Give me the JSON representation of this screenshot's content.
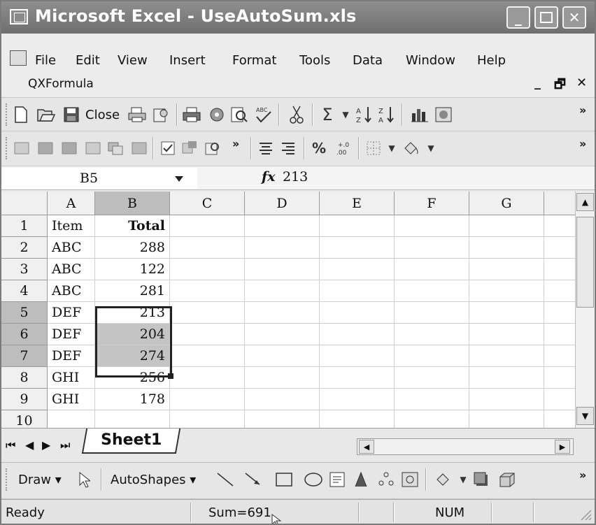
{
  "window": {
    "title": "Microsoft Excel - UseAutoSum.xls",
    "controls": {
      "minimize": "_",
      "maximize": "□",
      "close": "✕"
    }
  },
  "menu": {
    "items": [
      "File",
      "Edit",
      "View",
      "Insert",
      "Format",
      "Tools",
      "Data",
      "Window",
      "Help"
    ],
    "extra": "QXFormula",
    "mdi_controls": {
      "minimize": "_",
      "restore": "🗗",
      "close": "✕"
    }
  },
  "standard_toolbar": {
    "close_label": "Close",
    "overflow": "»"
  },
  "formatting_toolbar": {
    "overflow": "»"
  },
  "formula_bar": {
    "name_box": "B5",
    "fx": "fx",
    "value": "213"
  },
  "grid": {
    "columns": [
      "A",
      "B",
      "C",
      "D",
      "E",
      "F",
      "G"
    ],
    "rows": [
      {
        "num": "1",
        "a": "Item",
        "b": "Total"
      },
      {
        "num": "2",
        "a": "ABC",
        "b": "288"
      },
      {
        "num": "3",
        "a": "ABC",
        "b": "122"
      },
      {
        "num": "4",
        "a": "ABC",
        "b": "281"
      },
      {
        "num": "5",
        "a": "DEF",
        "b": "213"
      },
      {
        "num": "6",
        "a": "DEF",
        "b": "204"
      },
      {
        "num": "7",
        "a": "DEF",
        "b": "274"
      },
      {
        "num": "8",
        "a": "GHI",
        "b": "256"
      },
      {
        "num": "9",
        "a": "GHI",
        "b": "178"
      },
      {
        "num": "10",
        "a": "",
        "b": ""
      }
    ],
    "active_cell": "B5",
    "selected_range": "B5:B7"
  },
  "sheet_tabs": {
    "active": "Sheet1"
  },
  "drawing_toolbar": {
    "draw_label": "Draw",
    "autoshapes_label": "AutoShapes",
    "overflow": "»"
  },
  "status_bar": {
    "state": "Ready",
    "sum": "Sum=691",
    "num": "NUM"
  },
  "colors": {
    "title_bar": "#7f7f7f",
    "selection_fill": "#c4c4c4",
    "header_selected": "#bdbdbd"
  }
}
